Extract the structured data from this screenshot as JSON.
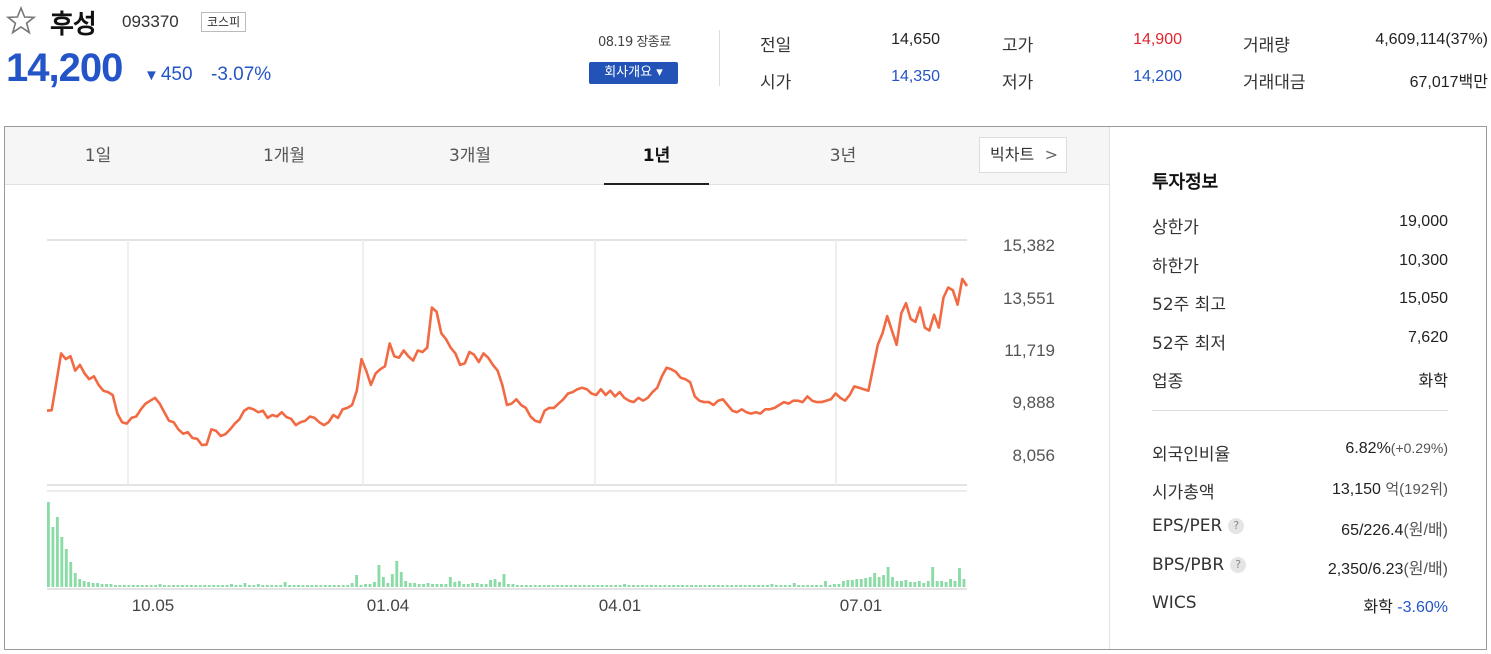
{
  "stock": {
    "name": "후성",
    "code": "093370",
    "market": "코스피",
    "price": "14,200",
    "change_arrow": "▼",
    "change": "450",
    "change_pct": "-3.07%",
    "date": "08.19 장종료",
    "company_button": "회사개요 ▾"
  },
  "summary": [
    {
      "label": "전일",
      "value": "14,650",
      "color": "#222222"
    },
    {
      "label": "고가",
      "value": "14,900",
      "color": "#e0242c"
    },
    {
      "label": "거래량",
      "value": "4,609,114(37%)",
      "color": "#222222"
    },
    {
      "label": "시가",
      "value": "14,350",
      "color": "#2355c8"
    },
    {
      "label": "저가",
      "value": "14,200",
      "color": "#2355c8"
    },
    {
      "label": "거래대금",
      "value": "67,017백만",
      "color": "#222222"
    }
  ],
  "tabs": [
    "1일",
    "1개월",
    "3개월",
    "1년",
    "3년"
  ],
  "active_tab": "1년",
  "big_chart_button": "빅차트",
  "chart_data": {
    "type": "line",
    "y_ticks": [
      "15,382",
      "13,551",
      "11,719",
      "9,888",
      "8,056"
    ],
    "x_ticks": [
      "10.05",
      "01.04",
      "04.01",
      "07.01"
    ],
    "ylim": [
      8056,
      15382
    ],
    "price_color": "#f26a43",
    "volume_color": "#8bdba6",
    "values": [
      9600,
      9620,
      10600,
      11600,
      11400,
      11500,
      11000,
      11200,
      10900,
      10700,
      10800,
      10500,
      10300,
      10250,
      10150,
      9500,
      9200,
      9150,
      9350,
      9400,
      9650,
      9850,
      9950,
      10050,
      9850,
      9550,
      9250,
      9200,
      8950,
      8800,
      8850,
      8650,
      8620,
      8400,
      8420,
      8950,
      8900,
      8720,
      8780,
      8950,
      9150,
      9300,
      9600,
      9700,
      9650,
      9550,
      9600,
      9350,
      9450,
      9400,
      9550,
      9380,
      9320,
      9100,
      9200,
      9250,
      9400,
      9350,
      9200,
      9100,
      9200,
      9450,
      9350,
      9650,
      9700,
      9800,
      10300,
      11400,
      11000,
      10500,
      10900,
      11050,
      11150,
      11950,
      11500,
      11450,
      11700,
      11500,
      11350,
      11700,
      11650,
      11800,
      13200,
      13050,
      12300,
      12100,
      11800,
      11600,
      11200,
      11250,
      11650,
      11550,
      11300,
      11600,
      11450,
      11200,
      11000,
      10500,
      9800,
      9850,
      10000,
      9800,
      9700,
      9400,
      9250,
      9200,
      9600,
      9700,
      9700,
      9850,
      10000,
      10200,
      10250,
      10350,
      10400,
      10350,
      10200,
      10150,
      10350,
      10150,
      10300,
      10100,
      10250,
      10050,
      9950,
      9900,
      10050,
      9950,
      10050,
      10250,
      10400,
      10800,
      11100,
      11050,
      10950,
      10750,
      10700,
      10600,
      10100,
      9950,
      9900,
      9900,
      9800,
      9950,
      10000,
      9800,
      9600,
      9550,
      9650,
      9550,
      9500,
      9550,
      9500,
      9650,
      9650,
      9700,
      9800,
      9900,
      9850,
      9950,
      9950,
      9900,
      10100,
      9950,
      9900,
      9900,
      9950,
      10000,
      10200,
      10050,
      9950,
      10150,
      10450,
      10400,
      10350,
      10300,
      11100,
      11900,
      12300,
      12900,
      12400,
      11900,
      13000,
      13350,
      12800,
      12700,
      13200,
      12500,
      12400,
      12950,
      12500,
      13550,
      13900,
      13800,
      13300,
      14200,
      13950
    ]
  },
  "info": {
    "title": "투자정보",
    "rows_top": [
      {
        "label": "상한가",
        "value": "19,000",
        "color": "#e0242c"
      },
      {
        "label": "하한가",
        "value": "10,300",
        "color": "#2355c8"
      },
      {
        "label": "52주 최고",
        "value": "15,050",
        "color": "#222222"
      },
      {
        "label": "52주 최저",
        "value": "7,620",
        "color": "#222222"
      },
      {
        "label": "업종",
        "value": "화학",
        "color": "#222222"
      }
    ],
    "foreign_label": "외국인비율",
    "foreign_value": "6.82%",
    "foreign_sub": "(+0.29%)",
    "mcap_label": "시가총액",
    "mcap_value": "13,150",
    "mcap_sub": "억(192위)",
    "eps_label": "EPS/PER",
    "eps_value": "65/226.4",
    "eps_sub": "(원/배)",
    "bps_label": "BPS/PBR",
    "bps_value": "2,350/6.23",
    "bps_sub": "(원/배)",
    "wics_label": "WICS",
    "wics_value": "화학",
    "wics_sub": "-3.60%",
    "help_icon": "?"
  }
}
